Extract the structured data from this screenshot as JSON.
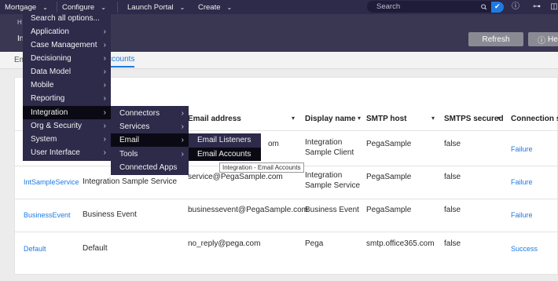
{
  "topbar": {
    "mortgage": "Mortgage",
    "configure": "Configure",
    "launch_portal": "Launch Portal",
    "create": "Create",
    "search_placeholder": "Search"
  },
  "subbar": {
    "crumb": "H",
    "title": "In",
    "refresh": "Refresh",
    "help": "He"
  },
  "tabs": {
    "email_prefix": "Em",
    "accounts": "ccounts"
  },
  "table": {
    "headers": {
      "email": "Email address",
      "display": "Display name",
      "smtp_host": "SMTP host",
      "smtps": "SMTPS secured",
      "connection": "Connection s"
    },
    "rows": [
      {
        "id": "",
        "desc": "",
        "email": "om",
        "display1": "Integration",
        "display2": "Sample Client",
        "smtp": "PegaSample",
        "smtps": "false",
        "status": "Failure"
      },
      {
        "id": "IntSampleService",
        "desc": "Integration Sample Service",
        "email": "service@PegaSample.com",
        "display1": "Integration",
        "display2": "Sample Service",
        "smtp": "PegaSample",
        "smtps": "false",
        "status": "Failure"
      },
      {
        "id": "BusinessEvent",
        "desc": "Business Event",
        "email": "businessevent@PegaSample.com",
        "display1": "Business Event",
        "display2": "",
        "smtp": "PegaSample",
        "smtps": "false",
        "status": "Failure"
      },
      {
        "id": "Default",
        "desc": "Default",
        "email": "no_reply@pega.com",
        "display1": "Pega",
        "display2": "",
        "smtp": "smtp.office365.com",
        "smtps": "false",
        "status": "Success"
      }
    ]
  },
  "menu_main": {
    "search_all": "Search all options...",
    "items": [
      "Application",
      "Case Management",
      "Decisioning",
      "Data Model",
      "Mobile",
      "Reporting",
      "Integration",
      "Org & Security",
      "System",
      "User Interface"
    ]
  },
  "menu_integration": {
    "items": [
      "Connectors",
      "Services",
      "Email",
      "Tools",
      "Connected Apps"
    ]
  },
  "menu_email": {
    "items": [
      "Email Listeners",
      "Email Accounts"
    ]
  },
  "tooltip": "Integration - Email Accounts",
  "colors": {
    "menu_bg": "#2d2a4a",
    "menu_active": "#0b0a14",
    "link": "#1f7ae0"
  }
}
